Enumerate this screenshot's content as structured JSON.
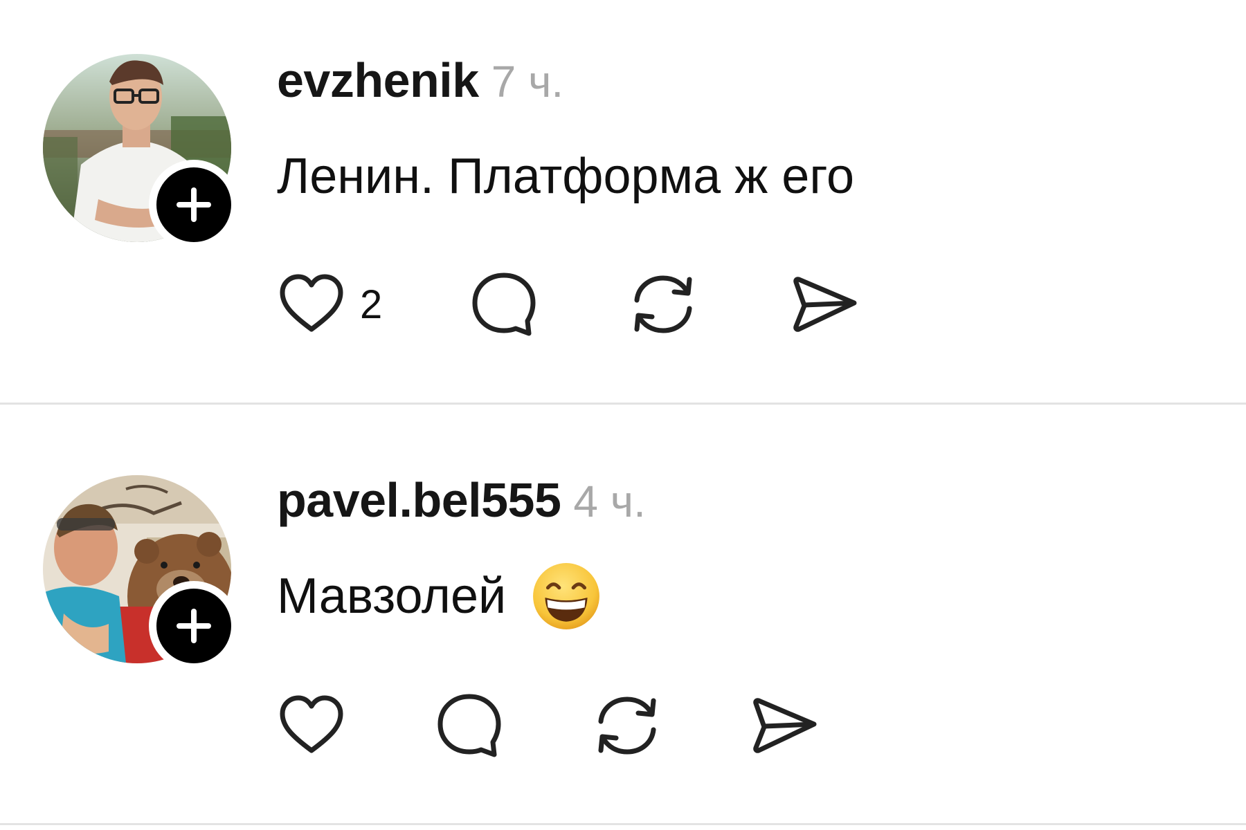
{
  "posts": [
    {
      "username": "evzhenik",
      "time": "7 ч.",
      "text": "Ленин. Платформа ж его",
      "likes": "2",
      "avatar_icon": "profile-photo-man-white-shirt",
      "badge_icon": "plus-icon"
    },
    {
      "username": "pavel.bel555",
      "time": "4 ч.",
      "text": "Мавзолей",
      "emoji": "grinning-face-with-smiling-eyes",
      "likes": "",
      "avatar_icon": "profile-photo-man-with-bear",
      "badge_icon": "plus-icon"
    }
  ],
  "action_icons": [
    "heart-icon",
    "comment-icon",
    "repost-icon",
    "share-icon"
  ],
  "colors": {
    "text": "#101010",
    "muted": "#a8a8a8",
    "divider": "#e3e3e3",
    "badge": "#000000"
  }
}
